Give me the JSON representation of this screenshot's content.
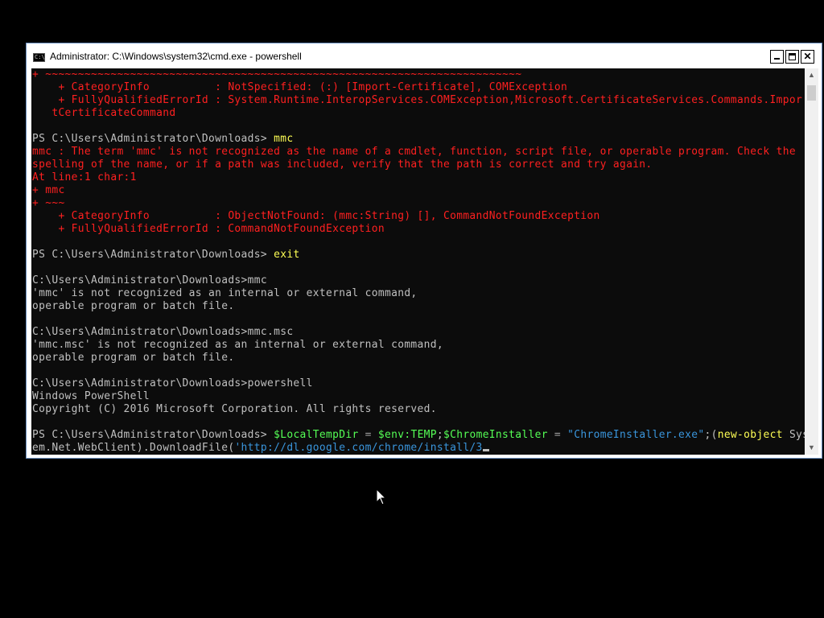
{
  "window": {
    "title": "Administrator: C:\\Windows\\system32\\cmd.exe - powershell",
    "icon_text": "C:\\",
    "close_glyph": "✕"
  },
  "console": {
    "lines": [
      {
        "class": "err",
        "text": "+ ~~~~~~~~~~~~~~~~~~~~~~~~~~~~~~~~~~~~~~~~~~~~~~~~~~~~~~~~~~~~~~~~~~~~~~~~~"
      },
      {
        "class": "err",
        "text": "    + CategoryInfo          : NotSpecified: (:) [Import-Certificate], COMException"
      },
      {
        "class": "err",
        "text": "    + FullyQualifiedErrorId : System.Runtime.InteropServices.COMException,Microsoft.CertificateServices.Commands.Impor"
      },
      {
        "class": "err",
        "text": "   tCertificateCommand"
      },
      {
        "class": "",
        "text": ""
      },
      {
        "segments": [
          {
            "class": "",
            "text": "PS C:\\Users\\Administrator\\Downloads> "
          },
          {
            "class": "cmd",
            "text": "mmc"
          }
        ]
      },
      {
        "class": "err",
        "text": "mmc : The term 'mmc' is not recognized as the name of a cmdlet, function, script file, or operable program. Check the"
      },
      {
        "class": "err",
        "text": "spelling of the name, or if a path was included, verify that the path is correct and try again."
      },
      {
        "class": "err",
        "text": "At line:1 char:1"
      },
      {
        "class": "err",
        "text": "+ mmc"
      },
      {
        "class": "err",
        "text": "+ ~~~"
      },
      {
        "class": "err",
        "text": "    + CategoryInfo          : ObjectNotFound: (mmc:String) [], CommandNotFoundException"
      },
      {
        "class": "err",
        "text": "    + FullyQualifiedErrorId : CommandNotFoundException"
      },
      {
        "class": "",
        "text": ""
      },
      {
        "segments": [
          {
            "class": "",
            "text": "PS C:\\Users\\Administrator\\Downloads> "
          },
          {
            "class": "cmd",
            "text": "exit"
          }
        ]
      },
      {
        "class": "",
        "text": ""
      },
      {
        "class": "",
        "text": "C:\\Users\\Administrator\\Downloads>mmc"
      },
      {
        "class": "",
        "text": "'mmc' is not recognized as an internal or external command,"
      },
      {
        "class": "",
        "text": "operable program or batch file."
      },
      {
        "class": "",
        "text": ""
      },
      {
        "class": "",
        "text": "C:\\Users\\Administrator\\Downloads>mmc.msc"
      },
      {
        "class": "",
        "text": "'mmc.msc' is not recognized as an internal or external command,"
      },
      {
        "class": "",
        "text": "operable program or batch file."
      },
      {
        "class": "",
        "text": ""
      },
      {
        "class": "",
        "text": "C:\\Users\\Administrator\\Downloads>powershell"
      },
      {
        "class": "",
        "text": "Windows PowerShell"
      },
      {
        "class": "",
        "text": "Copyright (C) 2016 Microsoft Corporation. All rights reserved."
      },
      {
        "class": "",
        "text": ""
      },
      {
        "segments": [
          {
            "class": "",
            "text": "PS C:\\Users\\Administrator\\Downloads> "
          },
          {
            "class": "var",
            "text": "$LocalTempDir"
          },
          {
            "class": "op",
            "text": " = "
          },
          {
            "class": "var",
            "text": "$env:TEMP"
          },
          {
            "class": "arg",
            "text": ";"
          },
          {
            "class": "var",
            "text": "$ChromeInstaller"
          },
          {
            "class": "op",
            "text": " = "
          },
          {
            "class": "str",
            "text": "\"ChromeInstaller.exe\""
          },
          {
            "class": "arg",
            "text": ";("
          },
          {
            "class": "cmd",
            "text": "new-object"
          },
          {
            "class": "arg",
            "text": " Syst"
          }
        ]
      },
      {
        "segments": [
          {
            "class": "arg",
            "text": "em.Net.WebClient).DownloadFile("
          },
          {
            "class": "str",
            "text": "'http://dl.google.com/chrome/install/3"
          }
        ],
        "cursor": true
      }
    ]
  },
  "scrollbar": {
    "up_glyph": "▲",
    "down_glyph": "▼"
  }
}
